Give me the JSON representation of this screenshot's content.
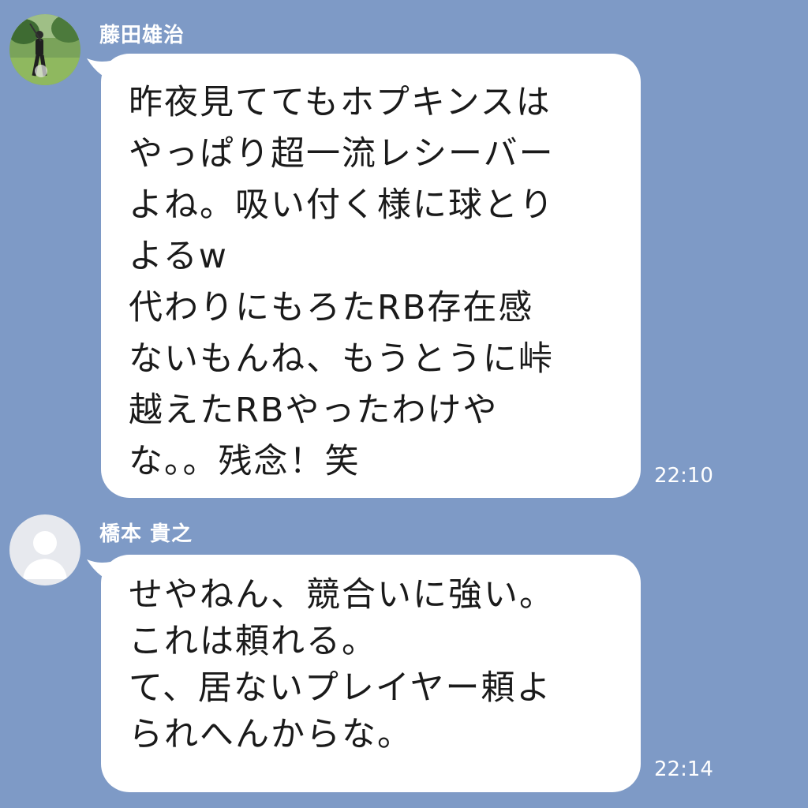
{
  "messages": [
    {
      "sender": "藤田雄治",
      "avatar_icon": "golfer-photo-avatar",
      "text": "昨夜見ててもホプキンスは\nやっぱり超一流レシーバー\nよね。吸い付く様に球とり\nよるw\n代わりにもろたRB存在感\nないもんね、もうとうに峠\n越えたRBやったわけや\nな。。残念！笑",
      "time": "22:10"
    },
    {
      "sender": "橋本 貴之",
      "avatar_icon": "default-user-avatar",
      "text": "せやねん、競合いに強い。\nこれは頼れる。\nて、居ないプレイヤー頼よ\nられへんからな。",
      "time": "22:14"
    }
  ],
  "colors": {
    "background": "#7e9ac6",
    "bubble": "#ffffff",
    "meta_text": "#ffffff"
  }
}
